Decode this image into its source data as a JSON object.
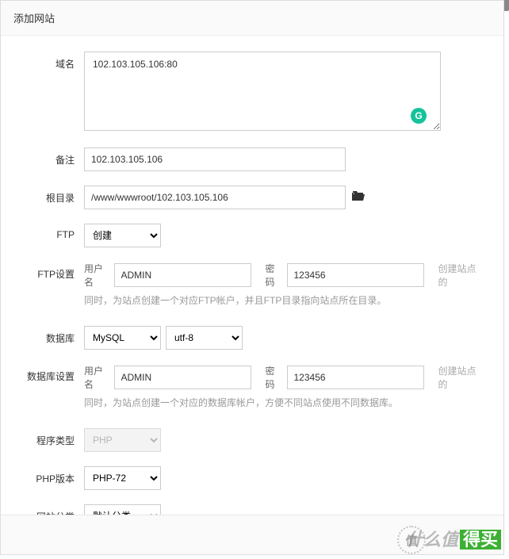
{
  "dialog": {
    "title": "添加网站"
  },
  "labels": {
    "domain": "域名",
    "remark": "备注",
    "root": "根目录",
    "ftp": "FTP",
    "ftp_settings": "FTP设置",
    "database": "数据库",
    "db_settings": "数据库设置",
    "program_type": "程序类型",
    "php_version": "PHP版本",
    "site_category": "网站分类",
    "username": "用户名",
    "password": "密码"
  },
  "values": {
    "domain": "102.103.105.106:80",
    "remark": "102.103.105.106",
    "root": "/www/wwwroot/102.103.105.106",
    "ftp_select": "创建",
    "ftp_user": "ADMIN",
    "ftp_pass": "123456",
    "db_select": "MySQL",
    "charset_select": "utf-8",
    "db_user": "ADMIN",
    "db_pass": "123456",
    "program_select": "PHP",
    "php_select": "PHP-72",
    "category_select": "默认分类"
  },
  "hints": {
    "create_site": "创建站点的",
    "ftp_helper": "同时，为站点创建一个对应FTP帐户，并且FTP目录指向站点所在目录。",
    "db_helper": "同时，为站点创建一个对应的数据库帐户，方便不同站点使用不同数据库。"
  },
  "watermark": {
    "circle": "值",
    "text1": "什么值",
    "text2": "得买"
  }
}
